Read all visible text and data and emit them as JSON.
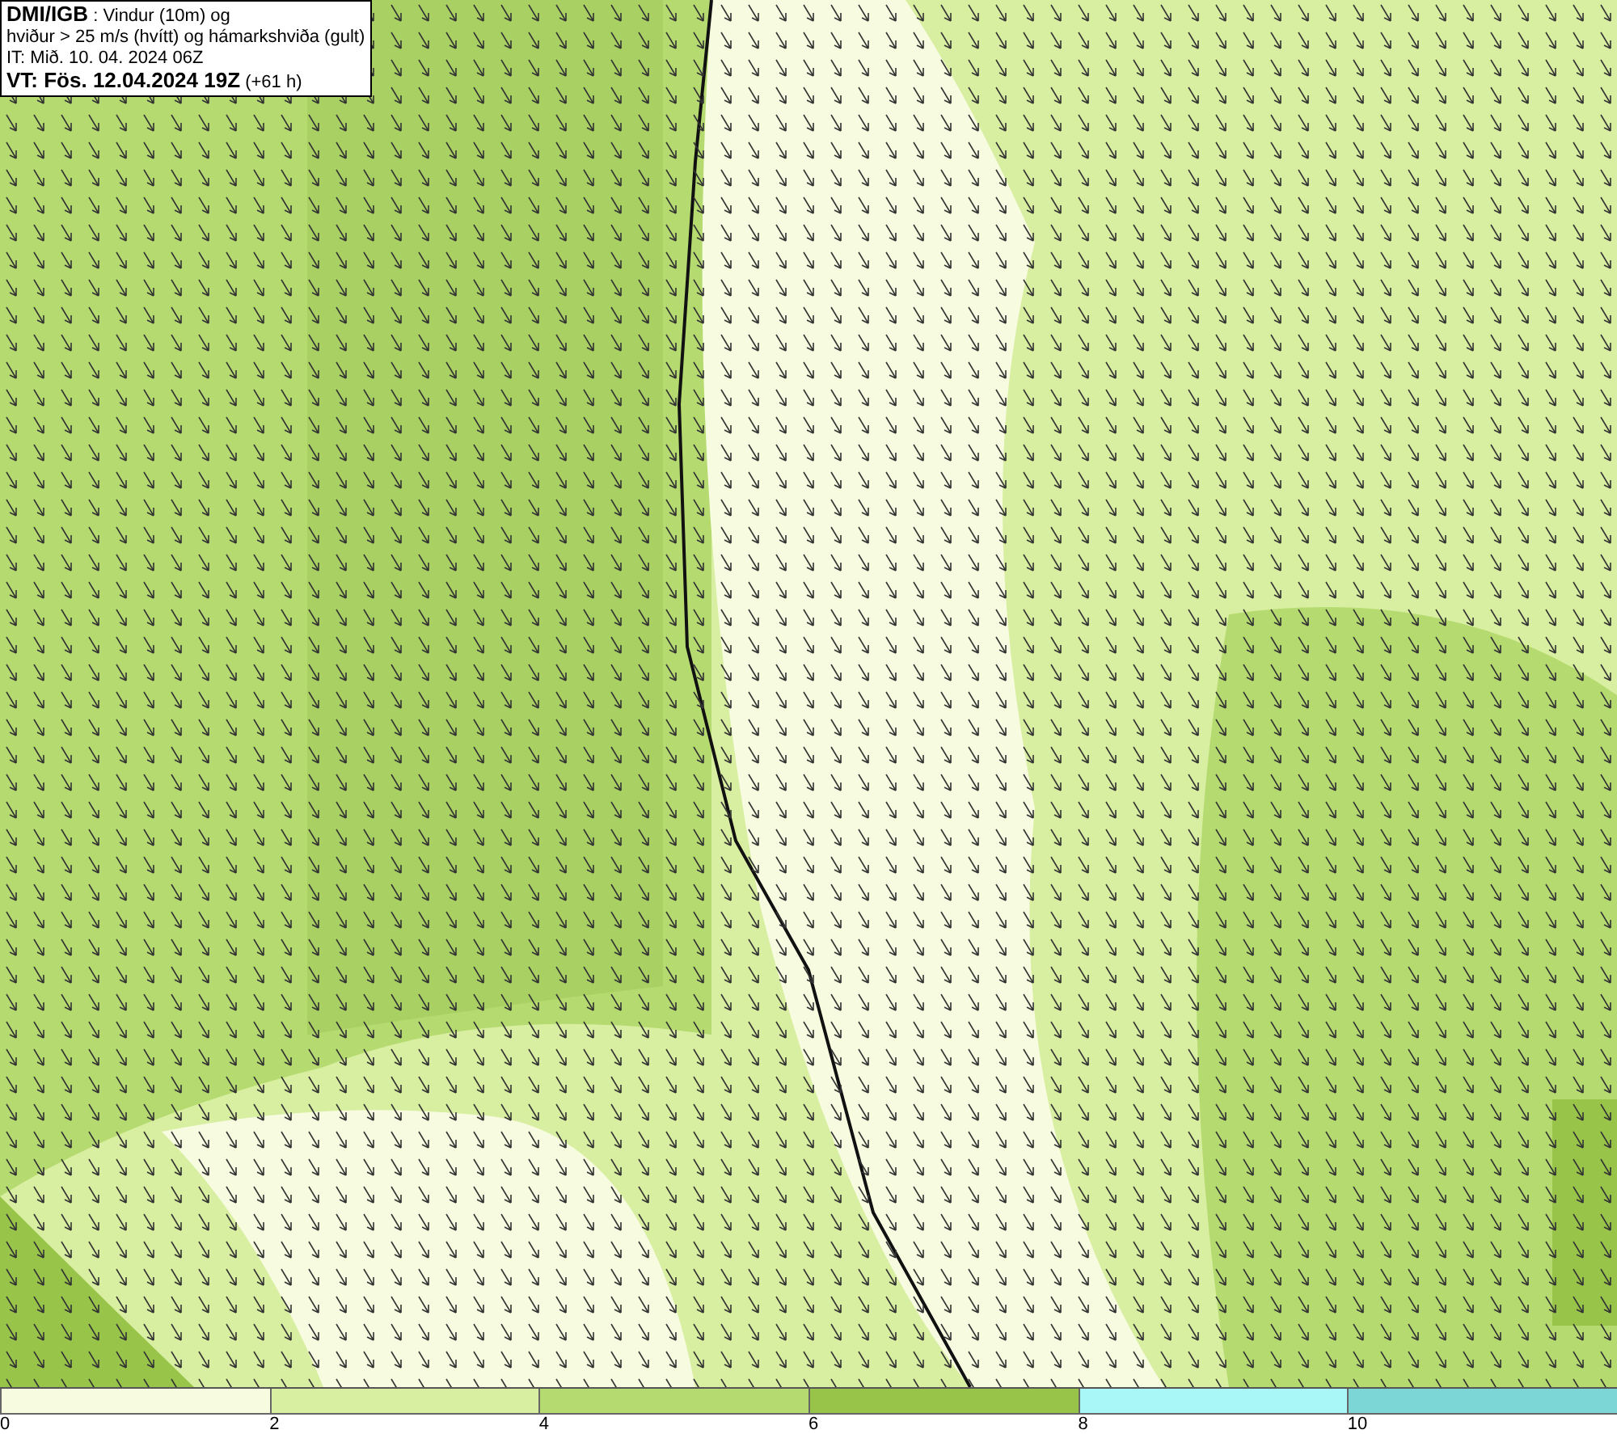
{
  "header": {
    "lines": [
      "**DMI/IGB** : Vindur (10m) og",
      "hviður > 25 m/s (hvítt) og hámarkshviða (gult)",
      "IT: Mið. 10. 04. 2024 06Z",
      "**VT: Fös. 12.04.2024 19Z** (+61 h)"
    ]
  },
  "legend": {
    "segments": [
      {
        "color": "#f7fbe0",
        "label": "0"
      },
      {
        "color": "#d8eea0",
        "label": "2"
      },
      {
        "color": "#b5db70",
        "label": "4"
      },
      {
        "color": "#98c44a",
        "label": "6"
      },
      {
        "color": "#aaf7f7",
        "label": "8"
      },
      {
        "color": "#7dd6d6",
        "label": "10"
      }
    ]
  }
}
